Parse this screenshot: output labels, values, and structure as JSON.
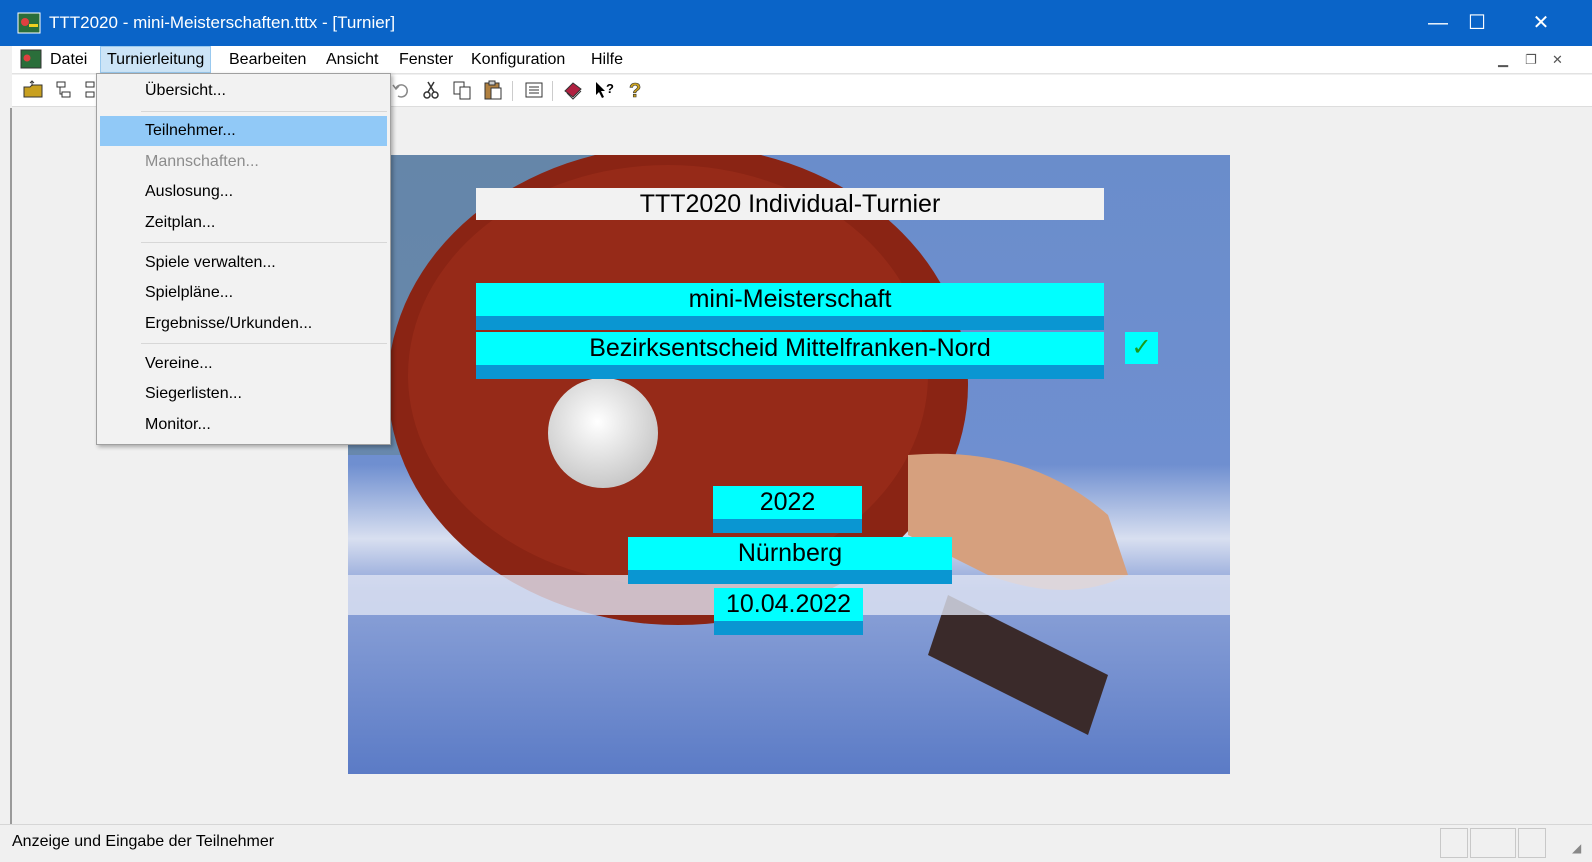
{
  "window": {
    "title": "TTT2020 - mini-Meisterschaften.tttx - [Turnier]",
    "min": "—",
    "max": "☐",
    "close": "✕"
  },
  "menubar": {
    "items": [
      "Datei",
      "Turnierleitung",
      "Bearbeiten",
      "Ansicht",
      "Fenster",
      "Konfiguration",
      "Hilfe"
    ],
    "active": "Turnierleitung"
  },
  "dropdown": {
    "items": [
      {
        "label": "Übersicht...",
        "state": "normal"
      },
      {
        "label": "Teilnehmer...",
        "state": "highlighted"
      },
      {
        "label": "Mannschaften...",
        "state": "disabled"
      },
      {
        "label": "Auslosung...",
        "state": "normal"
      },
      {
        "label": "Zeitplan...",
        "state": "normal"
      },
      {
        "label": "Spiele verwalten...",
        "state": "normal"
      },
      {
        "label": "Spielpläne...",
        "state": "normal"
      },
      {
        "label": "Ergebnisse/Urkunden...",
        "state": "normal"
      },
      {
        "label": "Vereine...",
        "state": "normal"
      },
      {
        "label": "Siegerlisten...",
        "state": "normal"
      },
      {
        "label": "Monitor...",
        "state": "normal"
      }
    ]
  },
  "toolbar": {
    "icons": [
      "open-folder-icon",
      "tree-icon",
      "tree2-icon",
      "undo-icon",
      "cut-icon",
      "copy-icon",
      "paste-icon",
      "list-icon",
      "book-icon",
      "context-help-icon",
      "help-icon"
    ]
  },
  "tournament": {
    "title": "TTT2020 Individual-Turnier",
    "name": "mini-Meisterschaft",
    "level": "Bezirksentscheid Mittelfranken-Nord",
    "check": "✓",
    "year": "2022",
    "city": "Nürnberg",
    "date": "10.04.2022"
  },
  "status": {
    "text": "Anzeige und Eingabe der Teilnehmer"
  },
  "colors": {
    "titlebar": "#0a64c8",
    "highlight": "#91c9f7",
    "cyan": "#00ffff",
    "band": "#0a96d2"
  }
}
